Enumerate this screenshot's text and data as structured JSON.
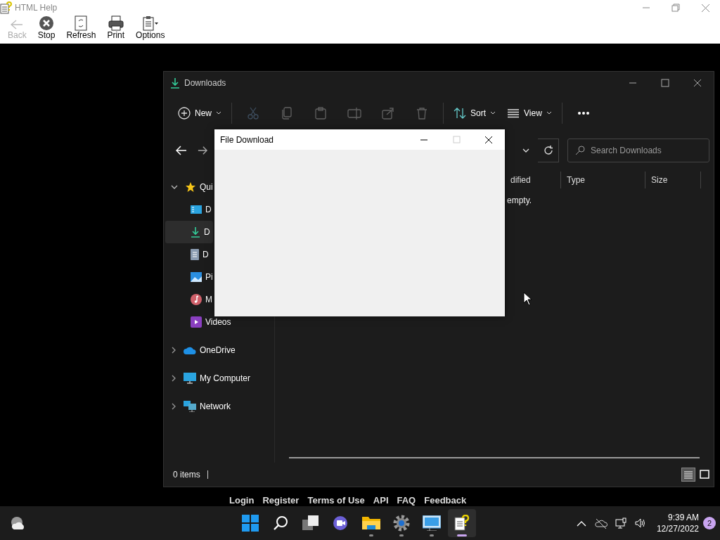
{
  "help_window": {
    "title": "HTML Help",
    "toolbar": [
      {
        "kind": "back",
        "label": "Back",
        "disabled": true
      },
      {
        "kind": "stop",
        "label": "Stop",
        "disabled": false
      },
      {
        "kind": "refresh",
        "label": "Refresh",
        "disabled": false
      },
      {
        "kind": "print",
        "label": "Print",
        "disabled": false
      },
      {
        "kind": "options",
        "label": "Options",
        "disabled": false
      }
    ]
  },
  "explorer": {
    "title": "Downloads",
    "commands": [
      {
        "kind": "new",
        "label": "New",
        "disabled": false
      },
      {
        "kind": "cut",
        "disabled": true
      },
      {
        "kind": "copy",
        "disabled": true
      },
      {
        "kind": "paste",
        "disabled": true
      },
      {
        "kind": "rename",
        "disabled": true
      },
      {
        "kind": "share",
        "disabled": true
      },
      {
        "kind": "delete",
        "disabled": true
      },
      {
        "kind": "sort",
        "label": "Sort",
        "disabled": false
      },
      {
        "kind": "view",
        "label": "View",
        "disabled": false
      },
      {
        "kind": "more",
        "disabled": false
      }
    ],
    "search": {
      "placeholder": "Search Downloads"
    },
    "nav": [
      {
        "kind": "star",
        "label": "Qui",
        "expanded": true,
        "selected": false,
        "children": [
          {
            "kind": "desktop",
            "label": "D",
            "selected": false
          },
          {
            "kind": "download",
            "label": "D",
            "selected": true
          },
          {
            "kind": "document",
            "label": "D",
            "selected": false
          },
          {
            "kind": "pictures",
            "label": "Pi",
            "selected": false
          },
          {
            "kind": "music",
            "label": "M",
            "selected": false
          },
          {
            "kind": "video",
            "label": "Videos",
            "selected": false
          }
        ]
      },
      {
        "kind": "cloud",
        "label": "OneDrive",
        "expanded": false,
        "selected": false
      },
      {
        "kind": "computer",
        "label": "My Computer",
        "expanded": false,
        "selected": false
      },
      {
        "kind": "network",
        "label": "Network",
        "expanded": false,
        "selected": false
      }
    ],
    "columns": [
      "dified",
      "Type",
      "Size"
    ],
    "empty_message": "empty.",
    "status": "0 items",
    "view_buttons": [
      {
        "kind": "details",
        "selected": true
      },
      {
        "kind": "tiles",
        "selected": false
      }
    ]
  },
  "dialog": {
    "title": "File Download"
  },
  "footer_links": [
    "Login",
    "Register",
    "Terms of Use",
    "API",
    "FAQ",
    "Feedback"
  ],
  "taskbar": {
    "apps": [
      {
        "kind": "start",
        "running": false,
        "active": false
      },
      {
        "kind": "search",
        "running": false,
        "active": false
      },
      {
        "kind": "taskview",
        "running": false,
        "active": false
      },
      {
        "kind": "chat",
        "running": false,
        "active": false
      },
      {
        "kind": "folder",
        "running": true,
        "active": false
      },
      {
        "kind": "gear",
        "running": true,
        "active": false
      },
      {
        "kind": "remote",
        "running": true,
        "active": false
      },
      {
        "kind": "help",
        "running": true,
        "active": true
      }
    ],
    "time": "9:39 AM",
    "date": "12/27/2022",
    "notifications": "2"
  }
}
